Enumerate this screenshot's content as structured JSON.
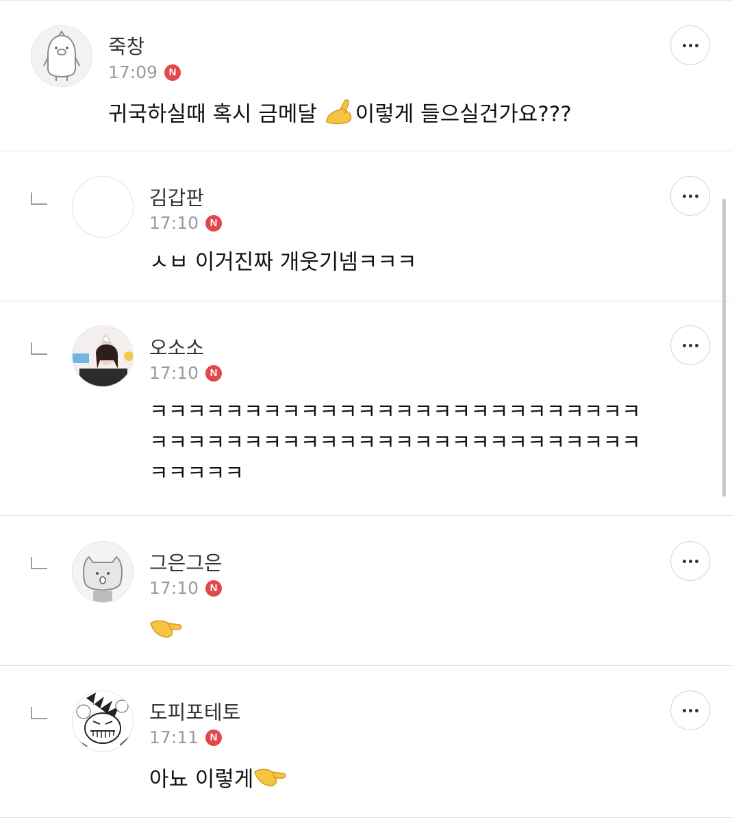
{
  "comments": [
    {
      "nickname": "죽창",
      "time": "17:09",
      "badge": "N",
      "text_before": "귀국하실때 혹시 금메달 ",
      "emoji": "pinching-hand-emoji",
      "text_after": "이렇게 들으실건가요???",
      "is_reply": false
    },
    {
      "nickname": "김갑판",
      "time": "17:10",
      "badge": "N",
      "lines": [
        "ㅅㅂ 이거진짜 개웃기넴ㅋㅋㅋ"
      ],
      "is_reply": true
    },
    {
      "nickname": "오소소",
      "time": "17:10",
      "badge": "N",
      "lines": [
        "ㅋㅋㅋㅋㅋㅋㅋㅋㅋㅋㅋㅋㅋㅋㅋㅋㅋㅋㅋㅋㅋㅋㅋㅋㅋㅋ",
        "ㅋㅋㅋㅋㅋㅋㅋㅋㅋㅋㅋㅋㅋㅋㅋㅋㅋㅋㅋㅋㅋㅋㅋㅋㅋㅋ",
        "ㅋㅋㅋㅋㅋ"
      ],
      "is_reply": true
    },
    {
      "nickname": "그은그은",
      "time": "17:10",
      "badge": "N",
      "emoji": "pinching-hand-emoji",
      "is_reply": true
    },
    {
      "nickname": "도피포테토",
      "time": "17:11",
      "badge": "N",
      "text_before": "아뇨 이렇게",
      "emoji": "pinching-hand-emoji",
      "is_reply": true
    }
  ],
  "colors": {
    "badge": "#e2474c",
    "time": "#9a9a9a",
    "divider": "#e3e3e3"
  }
}
